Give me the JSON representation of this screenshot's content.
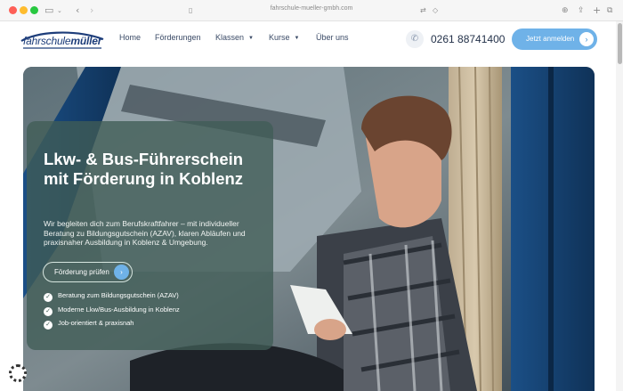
{
  "browser": {
    "url": "fahrschule-mueller-gmbh.com"
  },
  "header": {
    "logo_prefix": "fahrschule",
    "logo_suffix": "müller",
    "nav": [
      {
        "label": "Home"
      },
      {
        "label": "Förderungen"
      },
      {
        "label": "Klassen"
      },
      {
        "label": "Kurse"
      },
      {
        "label": "Über uns"
      }
    ],
    "phone": "0261 88741400",
    "cta_label": "Jetzt anmelden"
  },
  "hero": {
    "title": "Lkw- & Bus-Führerschein mit Förderung in Koblenz",
    "text": "Wir begleiten dich zum Berufskraftfahrer – mit individueller Beratung zu Bildungsgutschein (AZAV), klaren Abläufen und praxisnaher Ausbildung in Koblenz & Umgebung.",
    "button_label": "Förderung prüfen",
    "features": [
      "Beratung zum Bildungsgutschein (AZAV)",
      "Moderne Lkw/Bus-Ausbildung in Koblenz",
      "Job-orientiert & praxisnah"
    ]
  },
  "colors": {
    "accent": "#6fb2e8",
    "brand": "#1d3d7a",
    "card": "#405c56"
  },
  "icons": {
    "phone": "phone-icon",
    "arrow": "arrow-right-icon",
    "check": "check-icon"
  }
}
